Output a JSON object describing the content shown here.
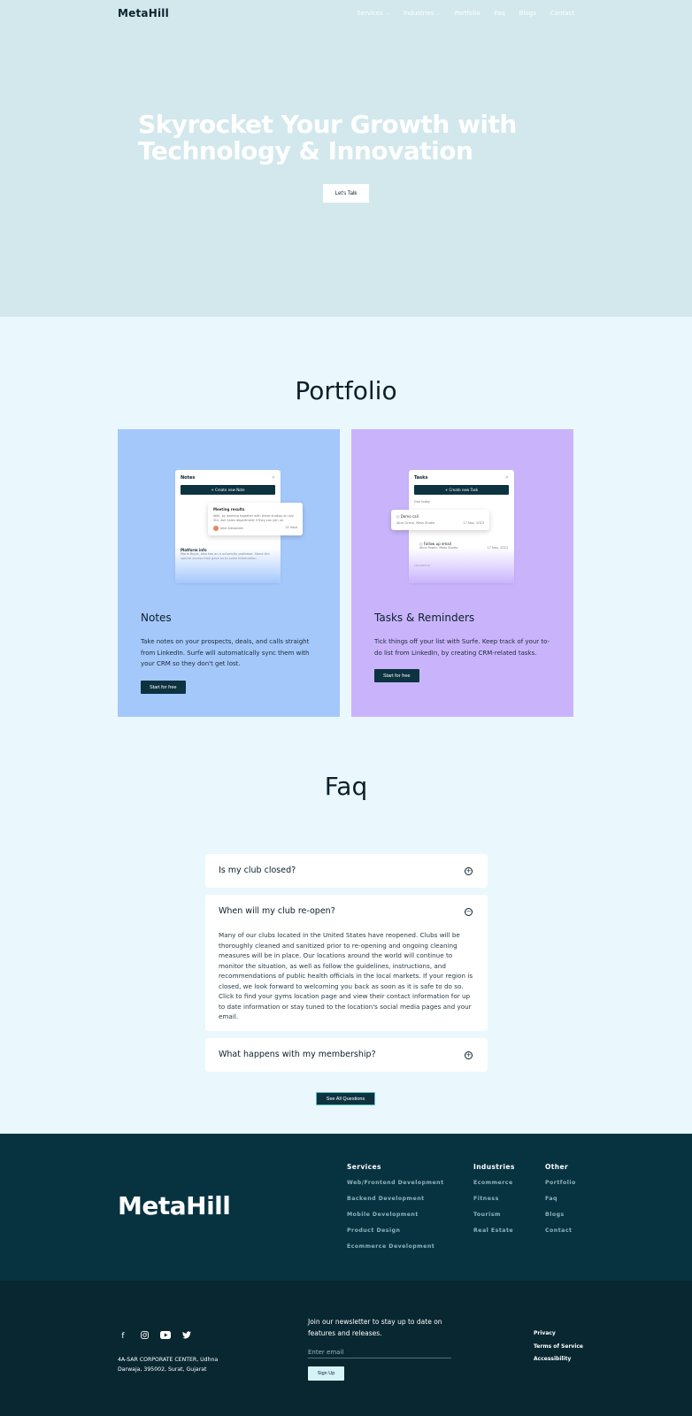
{
  "nav": {
    "logo": "MetaHill",
    "items": [
      {
        "label": "Services",
        "dropdown": true
      },
      {
        "label": "Industries",
        "dropdown": true
      },
      {
        "label": "Portfolio",
        "dropdown": false
      },
      {
        "label": "Faq",
        "dropdown": false
      },
      {
        "label": "Blogs",
        "dropdown": false
      },
      {
        "label": "Contact",
        "dropdown": false
      }
    ]
  },
  "hero": {
    "title_line1": "Skyrocket Your Growth with",
    "title_line2": "Technology & Innovation",
    "cta": "Let's Talk"
  },
  "portfolio": {
    "title": "Portfolio",
    "cards": [
      {
        "heading": "Notes",
        "text": "Take notes on your prospects, deals, and calls straight from LinkedIn. Surfe will automatically sync them with your CRM so they don't get lost.",
        "button": "Start for free",
        "mock": {
          "title": "Notes",
          "button": "Create new Note",
          "popup_title": "Meeting results",
          "popup_text": "Well, by working together with these studios on July 5th. Ask Sales department if they can join us.",
          "popup_author": "Jake Alexander",
          "popup_date": "21 Sept",
          "section": "Platform info",
          "section_text": "Marie Boyle, also has an a university professor. Some the special access they gave us to some information."
        }
      },
      {
        "heading": "Tasks & Reminders",
        "text": "Tick things off your list with Surfe. Keep track of your to-do list from LinkedIn, by creating CRM-related tasks.",
        "button": "Start for free",
        "mock": {
          "title": "Tasks",
          "button": "Create new Task",
          "group1": "Due today",
          "task1": "Demo call",
          "task1_meta": "Alice Grace, Mess Studio",
          "task1_date": "17 Nov, 2023",
          "task2": "Follow up email",
          "task2_meta": "Alice Power, Mess Studio",
          "task2_date": "17 Nov, 2023",
          "group2": "Upcoming"
        }
      }
    ]
  },
  "faq": {
    "title": "Faq",
    "items": [
      {
        "question": "Is my club closed?",
        "open": false,
        "answer": ""
      },
      {
        "question": "When will my club re-open?",
        "open": true,
        "answer": "Many of our clubs located in the United States have reopened. Clubs will be thoroughly cleaned and sanitized prior to re-opening and ongoing cleaning measures will be in place. Our locations around the world will continue to monitor the situation, as well as follow the guidelines, instructions, and recommendations of public health officials in the local markets. If your region is closed, we look forward to welcoming you back as soon as it is safe to do so. Click to find your gyms location page and view their contact information for up to date information or stay tuned to the location's social media pages and your email."
      },
      {
        "question": "What happens with my membership?",
        "open": false,
        "answer": ""
      }
    ],
    "see_all": "See All Questions"
  },
  "footer": {
    "logo": "MetaHill",
    "columns": [
      {
        "title": "Services",
        "links": [
          "Web/Frontend Development",
          "Backend Development",
          "Mobile Development",
          "Product Design",
          "Ecommerce Development"
        ]
      },
      {
        "title": "Industries",
        "links": [
          "Ecommerce",
          "Fitness",
          "Tourism",
          "Real Estate"
        ]
      },
      {
        "title": "Other",
        "links": [
          "Portfolio",
          "Faq",
          "Blogs",
          "Contact"
        ]
      }
    ],
    "social_icons": [
      "facebook-icon",
      "instagram-icon",
      "youtube-icon",
      "twitter-icon"
    ],
    "address_line1": "4A-SAR CORPORATE CENTER, Udhna",
    "address_line2": "Darwaja, 395002, Surat, Gujarat",
    "newsletter_text": "Join our newsletter to stay up to date on features and releases.",
    "email_placeholder": "Enter email",
    "signup": "Sign Up",
    "legal": [
      "Privacy",
      "Terms of Service",
      "Accessibility"
    ]
  },
  "colors": {
    "hero_bg": "#d2e8ec",
    "page_bg": "#eaf8fd",
    "notes_card": "#a5c8fb",
    "tasks_card": "#c9b4fc",
    "dark_button": "#0d3340",
    "footer_top": "#073341",
    "footer_bottom": "#082731"
  }
}
